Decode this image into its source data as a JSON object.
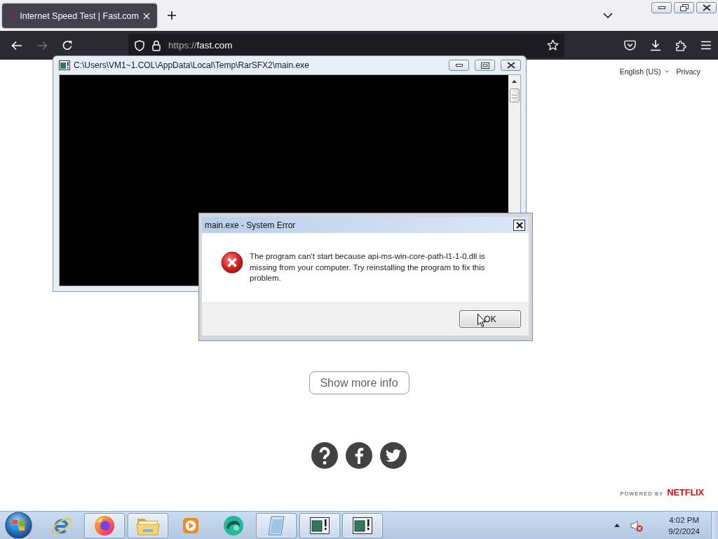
{
  "browser": {
    "tabs": [
      {
        "title": "Internet Speed Test | Fast.com",
        "selected": true
      }
    ],
    "nav_buttons": [
      {
        "kind": "back",
        "disabled": false
      },
      {
        "kind": "forward",
        "disabled": true
      },
      {
        "kind": "reload",
        "disabled": false
      }
    ],
    "address_bar": {
      "scheme": "https://",
      "host": "fast.com"
    }
  },
  "page": {
    "language_select": "English (US)",
    "privacy_link": "Privacy",
    "show_more_button": "Show more info",
    "social_links": [
      {
        "kind": "help"
      },
      {
        "kind": "facebook"
      },
      {
        "kind": "twitter"
      }
    ],
    "footer": {
      "powered_by": "POWERED BY",
      "brand": "NETFLIX"
    }
  },
  "console_window": {
    "title": "C:\\Users\\VM1~1.COL\\AppData\\Local\\Temp\\RarSFX2\\main.exe"
  },
  "error_dialog": {
    "title": "main.exe - System Error",
    "message": "The program can't start because api-ms-win-core-path-l1-1-0.dll is missing from your computer. Try reinstalling the program to fix this problem.",
    "button": "OK"
  },
  "taskbar": {
    "items": [
      {
        "kind": "ie",
        "open": false
      },
      {
        "kind": "firefox",
        "open": true
      },
      {
        "kind": "explorer",
        "open": true
      },
      {
        "kind": "media",
        "open": false
      },
      {
        "kind": "app",
        "open": false
      },
      {
        "kind": "notepad",
        "open": true
      },
      {
        "kind": "console",
        "open": true
      },
      {
        "kind": "console",
        "open": true
      }
    ],
    "tray": {
      "volume_muted": true
    },
    "clock": {
      "time": "4:02 PM",
      "date": "9/2/2024"
    }
  }
}
